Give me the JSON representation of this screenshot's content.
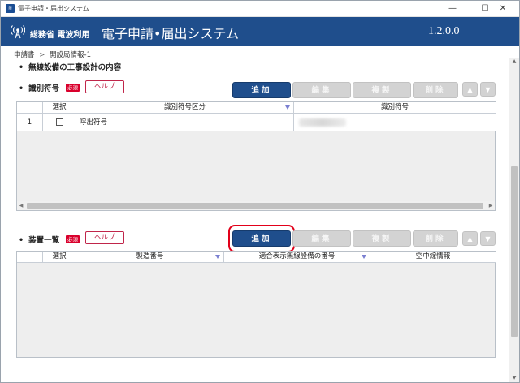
{
  "window": {
    "title": "電子申請・届出システム",
    "controls": {
      "minimize": "—",
      "maximize": "☐",
      "close": "✕"
    }
  },
  "header": {
    "org": "総務省 電波利用",
    "title": "電子申請•届出システム",
    "version": "1.2.0.0",
    "color": "#1f4e8c"
  },
  "breadcrumb": {
    "items": [
      "申請書",
      "開設局情報-1"
    ],
    "separator": ">"
  },
  "sections": {
    "main_title": "無線設備の工事設計の内容",
    "callsign": {
      "title": "識別符号",
      "badge": "必須",
      "help": "ヘルプ",
      "buttons": {
        "add": "追加",
        "edit": "編集",
        "copy": "複製",
        "delete": "削除"
      },
      "columns": [
        "",
        "選択",
        "識別符号区分",
        "識別符号"
      ],
      "rows": [
        {
          "no": "1",
          "selected": false,
          "kind": "呼出符号",
          "value": ""
        }
      ]
    },
    "devices": {
      "title": "装置一覧",
      "badge": "必須",
      "help": "ヘルプ",
      "buttons": {
        "add": "追加",
        "edit": "編集",
        "copy": "複製",
        "delete": "削除"
      },
      "columns": [
        "",
        "選択",
        "製造番号",
        "適合表示無線設備の番号",
        "空中線情報"
      ],
      "rows": []
    }
  },
  "icons": {
    "up": "triangle-up-icon",
    "down": "triangle-down-icon",
    "highlight": "#e2001a"
  }
}
